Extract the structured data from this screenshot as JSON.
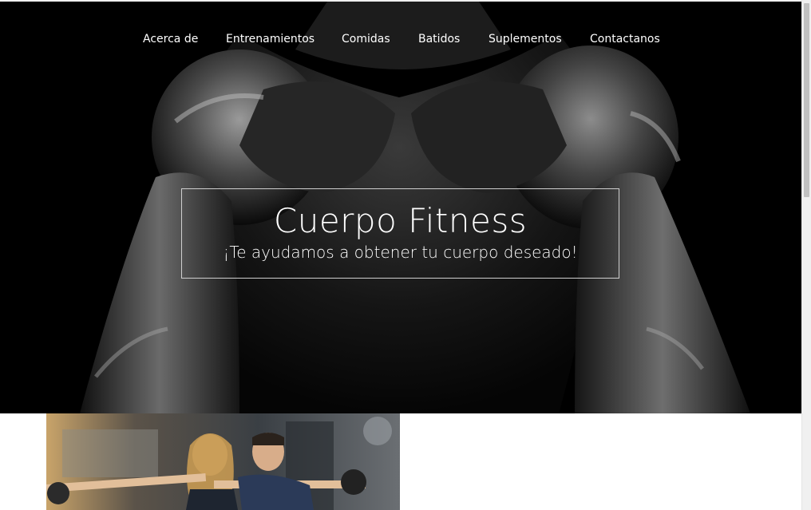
{
  "nav": {
    "items": [
      "Acerca de",
      "Entrenamientos",
      "Comidas",
      "Batidos",
      "Suplementos",
      "Contactanos"
    ]
  },
  "hero": {
    "title": "Cuerpo Fitness",
    "subtitle": "¡Te ayudamos a obtener tu cuerpo deseado!"
  },
  "colors": {
    "hero_bg": "#000000",
    "text": "#ffffff",
    "box_border": "#cfcfcf"
  }
}
